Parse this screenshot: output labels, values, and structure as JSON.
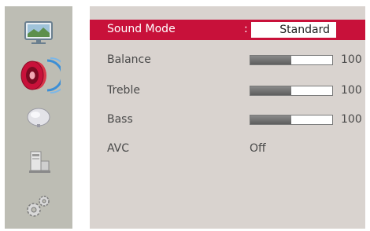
{
  "sidebar": {
    "items": [
      {
        "icon": "picture-icon"
      },
      {
        "icon": "sound-icon",
        "selected": true
      },
      {
        "icon": "channel-icon"
      },
      {
        "icon": "function-icon"
      },
      {
        "icon": "setup-icon"
      }
    ]
  },
  "menu": {
    "sound_mode": {
      "label": "Sound Mode",
      "separator": ":",
      "value": "Standard"
    },
    "balance": {
      "label": "Balance",
      "value": "100",
      "level": 0.5
    },
    "treble": {
      "label": "Treble",
      "value": "100",
      "level": 0.5
    },
    "bass": {
      "label": "Bass",
      "value": "100",
      "level": 0.5
    },
    "avc": {
      "label": "AVC",
      "value": "Off"
    }
  },
  "colors": {
    "highlight": "#c8113a",
    "panel": "#d9d3cf",
    "sidebar": "#bdbdb4"
  }
}
